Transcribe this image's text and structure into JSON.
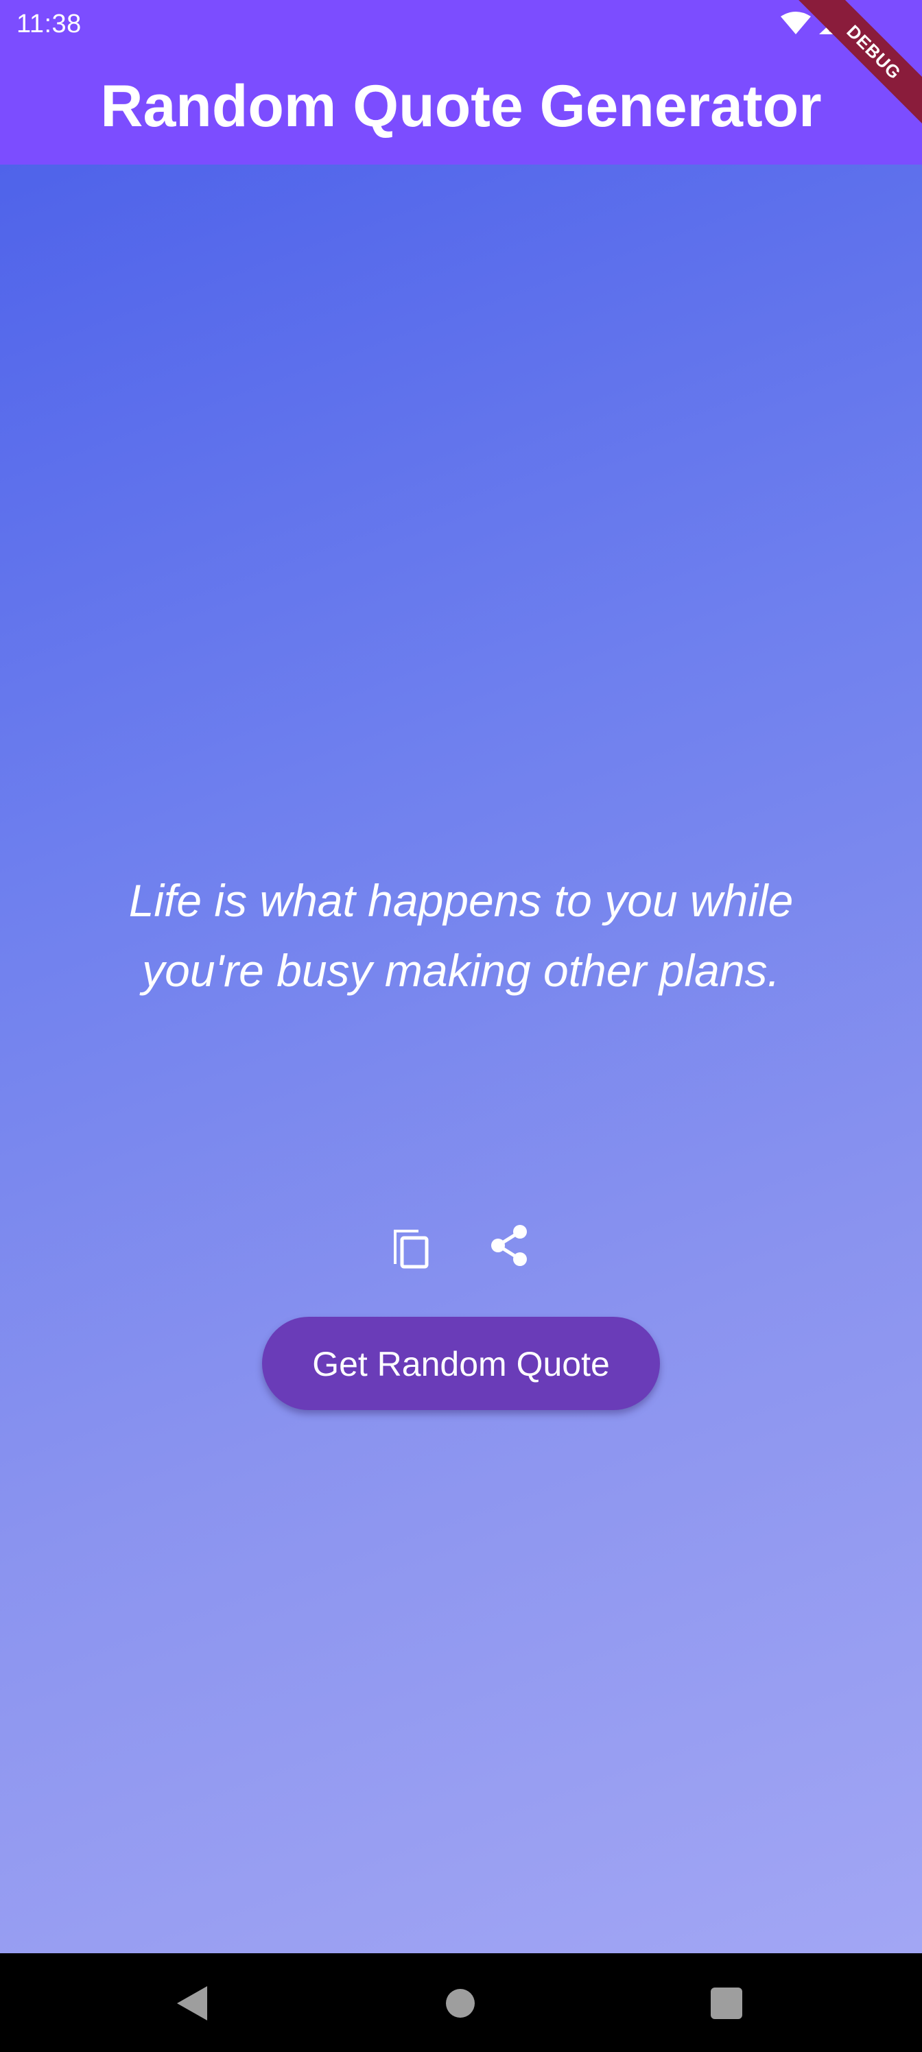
{
  "status_bar": {
    "time": "11:38",
    "icons": [
      "wifi-icon",
      "signal-icon"
    ]
  },
  "app_bar": {
    "title": "Random Quote Generator",
    "debug_label": "DEBUG",
    "color": "#7c4dff"
  },
  "quote": {
    "text": "Life is what happens to you while you're busy making other plans."
  },
  "actions": {
    "copy_icon": "copy-icon",
    "share_icon": "share-icon"
  },
  "button": {
    "label": "Get Random Quote",
    "color": "#6a3cb8"
  },
  "navigation": {
    "icons": [
      "back-icon",
      "home-icon",
      "recent-apps-icon"
    ]
  },
  "colors": {
    "gradient_start": "#4f63ea",
    "gradient_end": "#a2a6f4"
  }
}
